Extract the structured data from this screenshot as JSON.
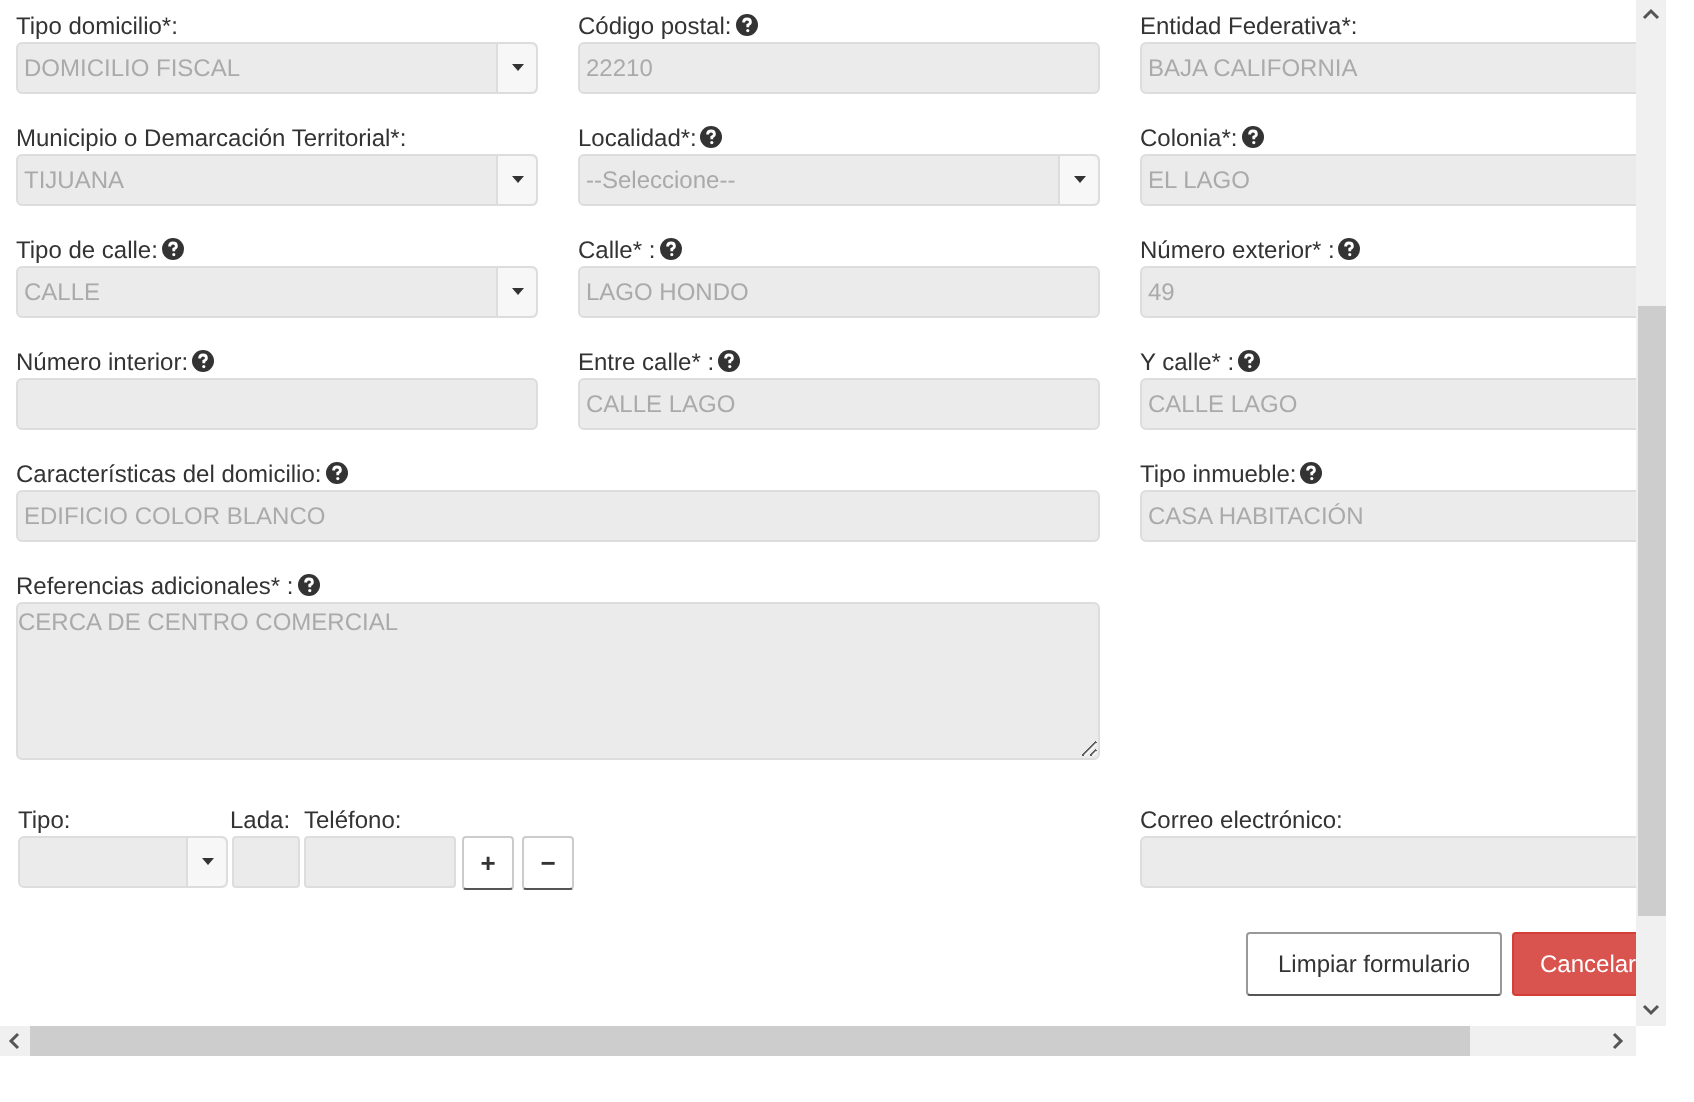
{
  "fields": [
    {
      "kind": "select",
      "label": "Tipo domicilio*:",
      "help": false,
      "value": "DOMICILIO FISCAL"
    },
    {
      "kind": "text",
      "label": "Código postal:",
      "help": true,
      "value": "22210"
    },
    {
      "kind": "text",
      "label": "Entidad Federativa*:",
      "help": false,
      "value": "BAJA CALIFORNIA"
    },
    {
      "kind": "select",
      "label": "Municipio o Demarcación Territorial*:",
      "help": false,
      "value": "TIJUANA"
    },
    {
      "kind": "select",
      "label": "Localidad*:",
      "help": true,
      "value": "--Seleccione--"
    },
    {
      "kind": "text",
      "label": "Colonia*:",
      "help": true,
      "value": "EL LAGO"
    },
    {
      "kind": "select",
      "label": "Tipo de calle:",
      "help": true,
      "value": "CALLE"
    },
    {
      "kind": "text",
      "label": "Calle* :",
      "help": true,
      "value": "LAGO HONDO"
    },
    {
      "kind": "text",
      "label": "Número exterior* :",
      "help": true,
      "value": "49"
    },
    {
      "kind": "text",
      "label": "Número interior:",
      "help": true
    },
    {
      "kind": "text",
      "label": "Entre calle* :",
      "help": true,
      "value": "CALLE LAGO"
    },
    {
      "kind": "text",
      "label": "Y calle* :",
      "help": true,
      "value": "CALLE LAGO"
    },
    {
      "kind": "wide_text",
      "label": "Características del domicilio:",
      "help": true,
      "value": "EDIFICIO COLOR BLANCO"
    },
    {
      "kind": "text",
      "label": "Tipo inmueble:",
      "help": true,
      "value": "CASA HABITACIÓN"
    },
    {
      "kind": "textarea",
      "label": "Referencias adicionales* :",
      "help": true,
      "value": "CERCA DE CENTRO COMERCIAL"
    },
    {
      "kind": "empty"
    },
    {
      "kind": "phone",
      "type_label": "Tipo:",
      "lada_label": "Lada:",
      "phone_label": "Teléfono:",
      "add": "+",
      "remove": "−"
    },
    {
      "kind": "text",
      "label": "Correo electrónico:",
      "help": false
    }
  ],
  "buttons": [
    {
      "label": "Limpiar formulario",
      "kind": "default"
    },
    {
      "label": "Cancelar",
      "kind": "danger"
    }
  ]
}
